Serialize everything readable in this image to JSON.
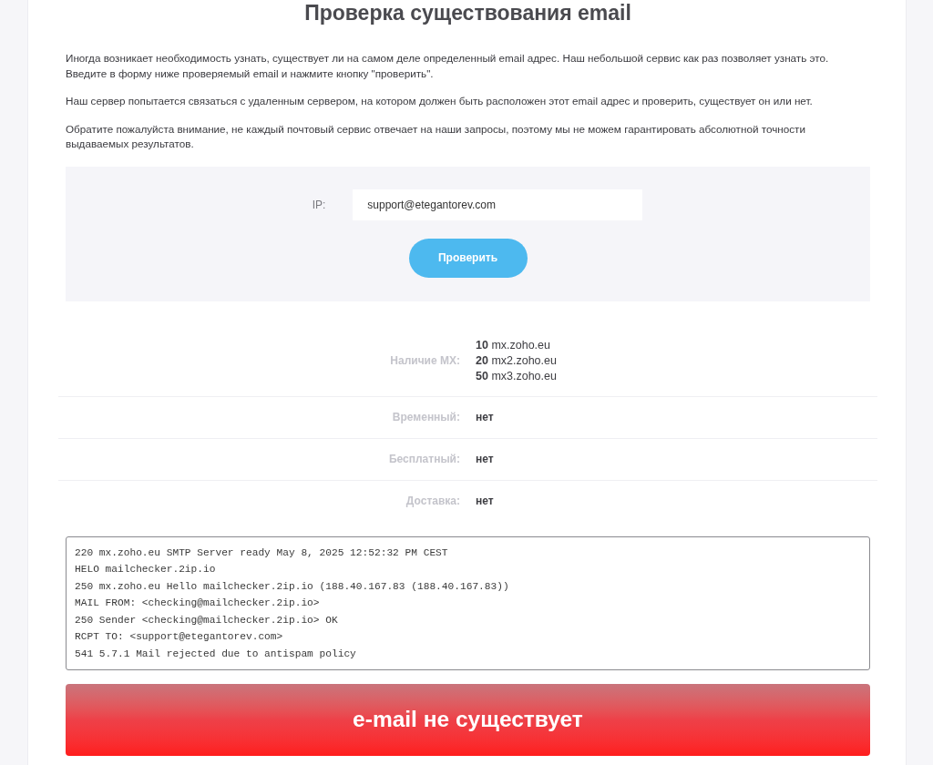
{
  "title": "Проверка существования email",
  "intro": [
    "Иногда возникает необходимость узнать, существует ли на самом деле определенный email адрес. Наш небольшой сервис как раз позволяет узнать это. Введите в форму ниже проверяемый email и нажмите кнопку \"проверить\".",
    "Наш сервер попытается связаться с удаленным сервером, на котором должен быть расположен этот email адрес и проверить, существует он или нет.",
    "Обратите пожалуйста внимание, не каждый почтовый сервис отвечает на наши запросы, поэтому мы не можем гарантировать абсолютной точности выдаваемых результатов."
  ],
  "form": {
    "label": "IP:",
    "input": {
      "value": "support@etegantorev.com"
    },
    "button": "Проверить"
  },
  "results": [
    {
      "label": "Наличие MX:",
      "kind": "list",
      "items": [
        "**10** mx.zoho.eu",
        "**20** mx2.zoho.eu",
        "**50** mx3.zoho.eu"
      ]
    },
    {
      "label": "Временный:",
      "kind": "text",
      "value": "нет"
    },
    {
      "label": "Бесплатный:",
      "kind": "text",
      "value": "нет"
    },
    {
      "label": "Доставка:",
      "kind": "text",
      "value": "нет"
    }
  ],
  "log": [
    "220 mx.zoho.eu SMTP Server ready May 8, 2025 12:52:32 PM CEST",
    "HELO mailchecker.2ip.io",
    "250 mx.zoho.eu Hello mailchecker.2ip.io (188.40.167.83 (188.40.167.83))",
    "MAIL FROM: <checking@mailchecker.2ip.io>",
    "250 Sender <checking@mailchecker.2ip.io> OK",
    "RCPT TO: <support@etegantorev.com>",
    "541 5.7.1 Mail rejected due to antispam policy"
  ],
  "verdict": {
    "text": "e-mail не существует",
    "exists": false
  }
}
